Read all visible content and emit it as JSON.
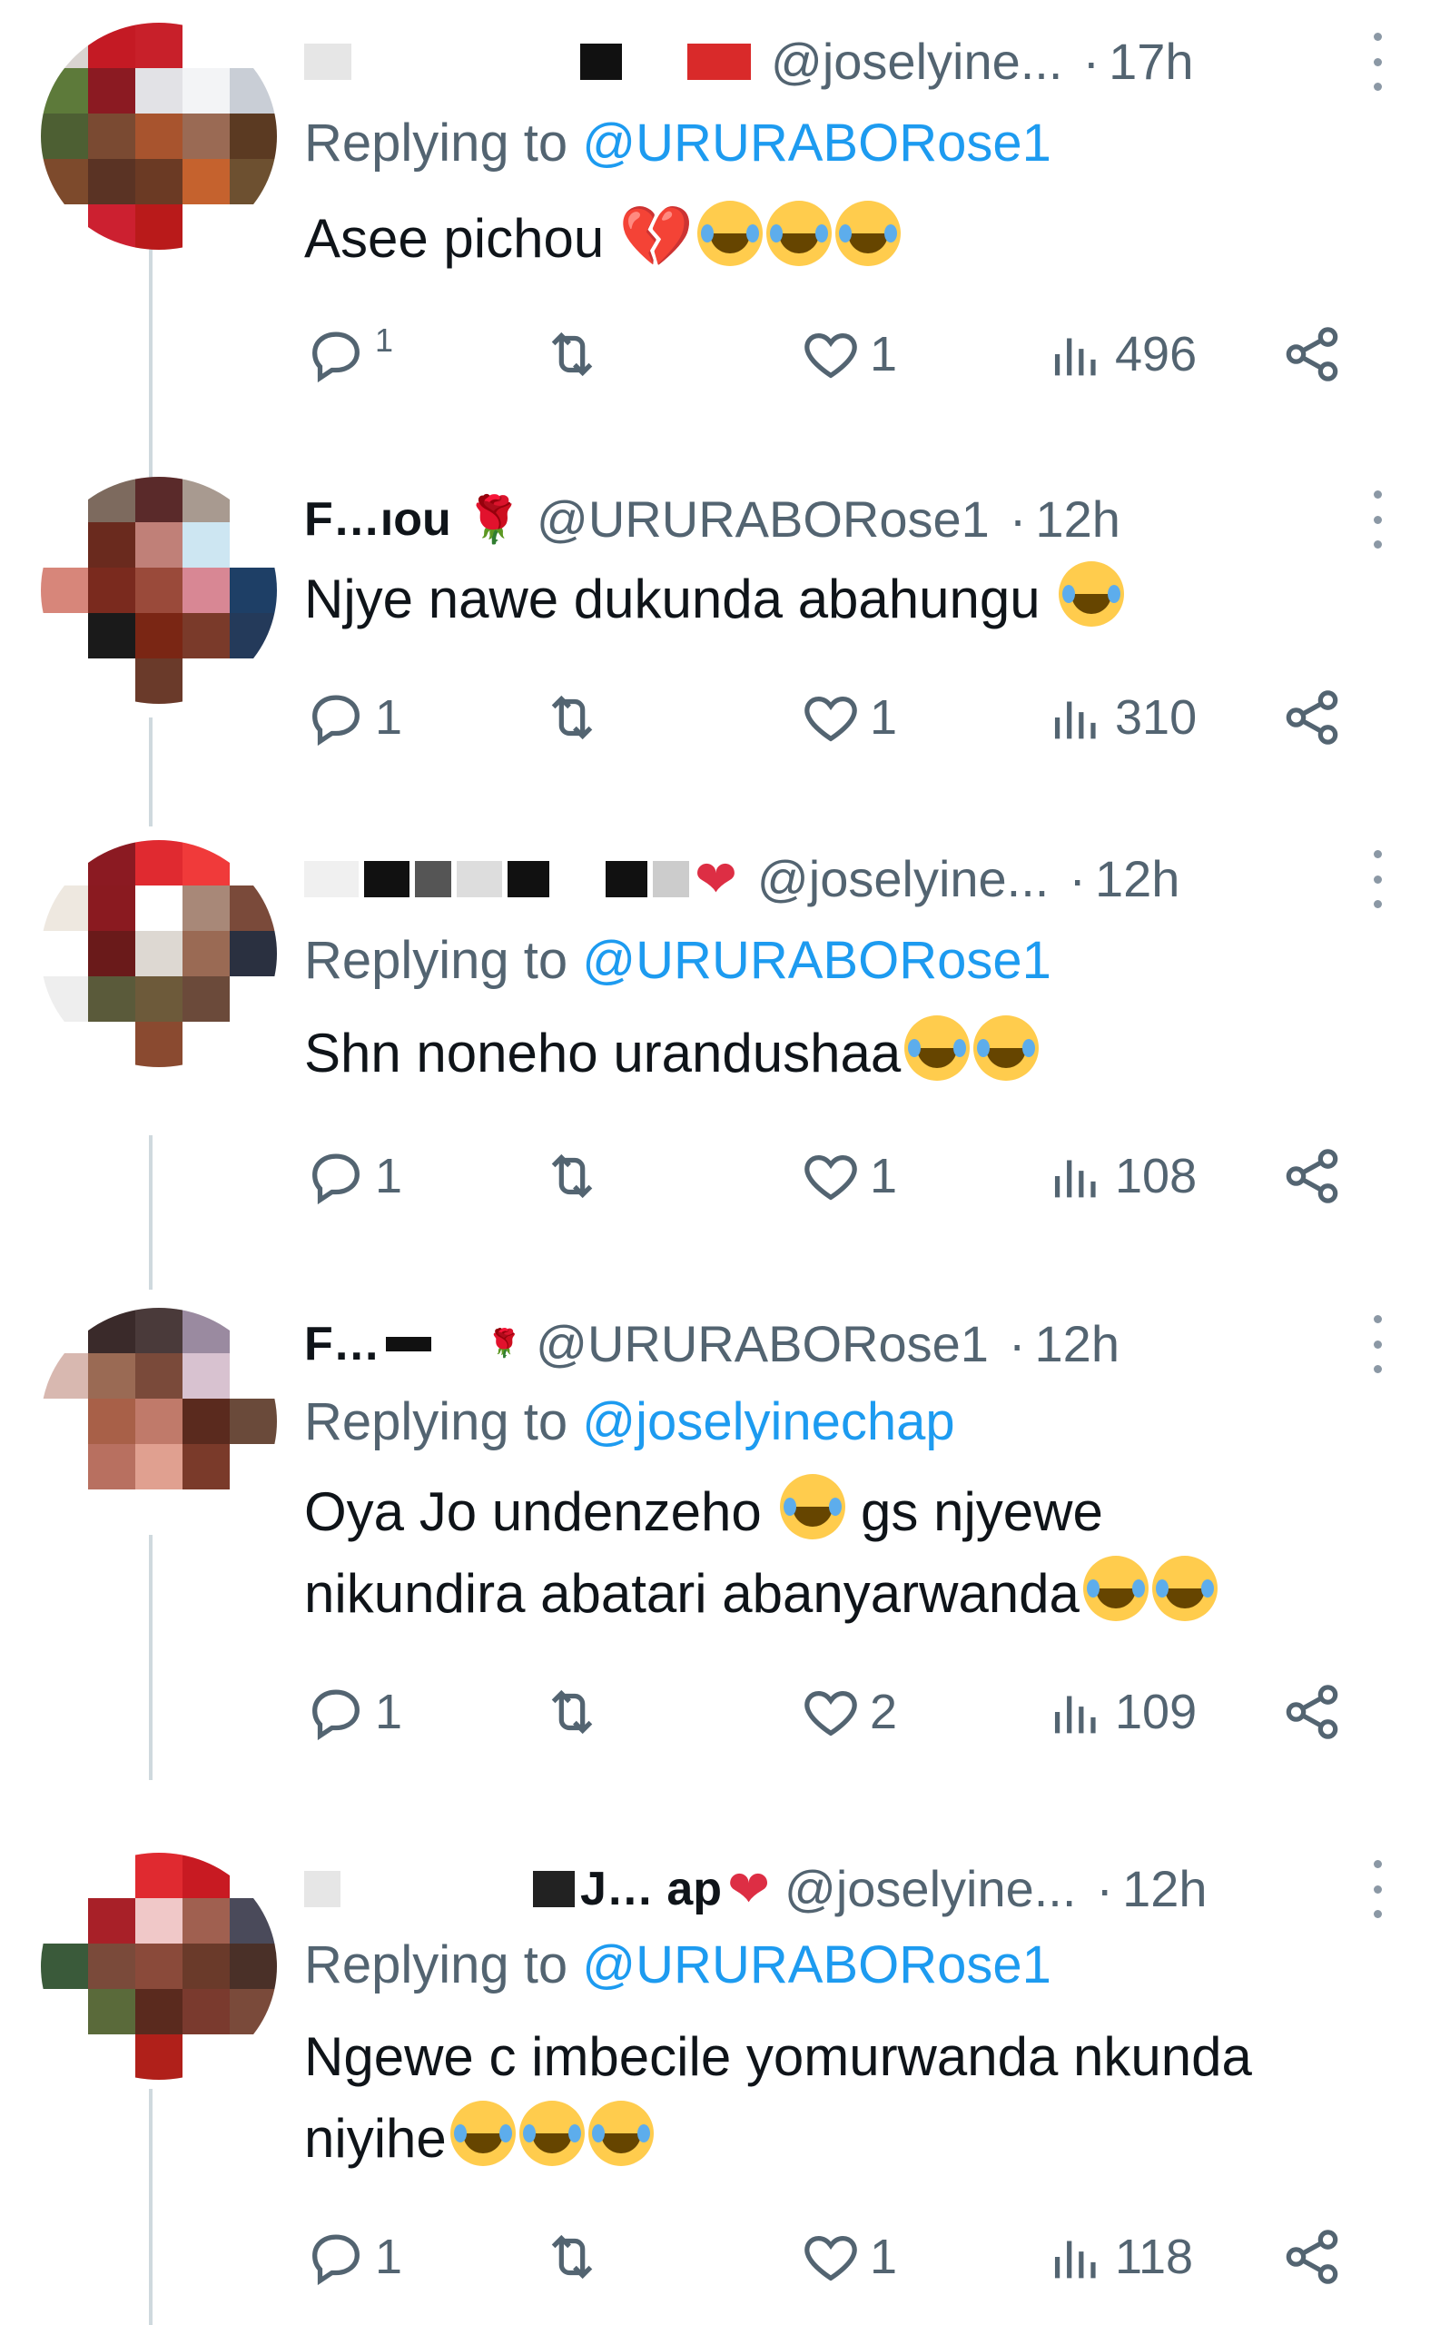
{
  "colors": {
    "link": "#1d9bf0",
    "muted": "#536471",
    "text": "#0f1419",
    "thread_line": "#cfd9de"
  },
  "tweets": [
    {
      "display_name": "",
      "name_emoji": "heart-emoji",
      "handle": "@joselyine...",
      "time": "17h",
      "replying_prefix": "Replying to",
      "replying_to": "@URURABORose1",
      "text": "Asee pichou",
      "emojis": [
        "broken-heart",
        "laugh",
        "laugh",
        "laugh"
      ],
      "replies": "1",
      "retweets": "",
      "likes": "1",
      "views": "496"
    },
    {
      "display_name": "F…ıou",
      "name_emoji": "rose-emoji",
      "handle": "@URURABORose1",
      "time": "12h",
      "replying_prefix": "",
      "replying_to": "",
      "text": "Njye nawe dukunda abahungu",
      "emojis": [
        "laugh"
      ],
      "replies": "1",
      "retweets": "",
      "likes": "1",
      "views": "310"
    },
    {
      "display_name": "",
      "name_emoji": "heart-emoji",
      "handle": "@joselyine...",
      "time": "12h",
      "replying_prefix": "Replying to",
      "replying_to": "@URURABORose1",
      "text": "Shn noneho urandushaa",
      "emojis": [
        "laugh",
        "laugh"
      ],
      "replies": "1",
      "retweets": "",
      "likes": "1",
      "views": "108"
    },
    {
      "display_name": "F…",
      "name_emoji": "rose-emoji",
      "handle": "@URURABORose1",
      "time": "12h",
      "replying_prefix": "Replying to",
      "replying_to": "@joselyinechap",
      "text_line1": "Oya Jo undenzeho",
      "text_line1_tail": "gs njyewe",
      "text_line2": "nikundira abatari abanyarwanda",
      "replies": "1",
      "retweets": "",
      "likes": "2",
      "views": "109"
    },
    {
      "display_name": "J… ap",
      "name_emoji": "heart-emoji",
      "handle": "@joselyine...",
      "time": "12h",
      "replying_prefix": "Replying to",
      "replying_to": "@URURABORose1",
      "text_line1": "Ngewe c imbecile yomurwanda nkunda",
      "text_line2": "niyihe",
      "replies": "1",
      "retweets": "",
      "likes": "1",
      "views": "118"
    }
  ]
}
